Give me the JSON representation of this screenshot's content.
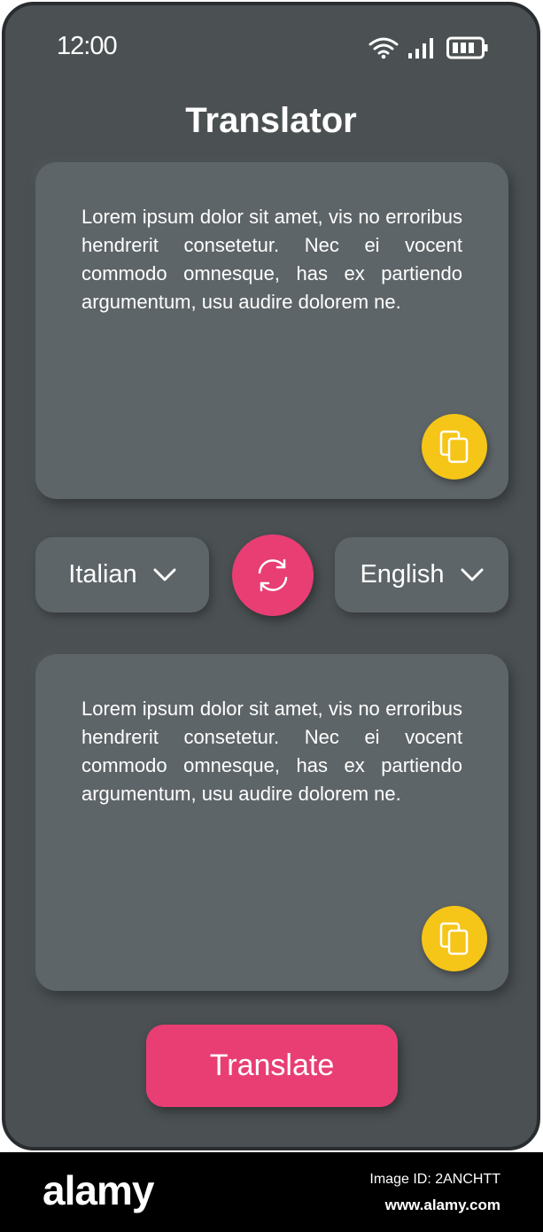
{
  "status_bar": {
    "time": "12:00",
    "icons": [
      "wifi-icon",
      "signal-icon",
      "battery-icon"
    ]
  },
  "app": {
    "title": "Translator"
  },
  "source_card": {
    "text": "Lorem ipsum dolor sit amet, vis no erroribus hendrerit consetetur. Nec ei vocent commodo omnesque, has ex partiendo argumentum, usu audire dolorem ne.",
    "copy_icon": "copy-icon"
  },
  "language_bar": {
    "source_language": "Italian",
    "target_language": "English",
    "swap_icon": "swap-icon"
  },
  "target_card": {
    "text": "Lorem ipsum dolor sit amet, vis no erroribus hendrerit consetetur. Nec ei vocent commodo omnesque, has ex partiendo argumentum, usu audire dolorem ne.",
    "copy_icon": "copy-icon"
  },
  "actions": {
    "translate_label": "Translate"
  },
  "footer": {
    "logo": "alamy",
    "image_id": "Image ID: 2ANCHTT",
    "url": "www.alamy.com"
  },
  "colors": {
    "background": "#4b5153",
    "card": "#5e6568",
    "accent": "#e83e74",
    "copy": "#f5c518"
  }
}
